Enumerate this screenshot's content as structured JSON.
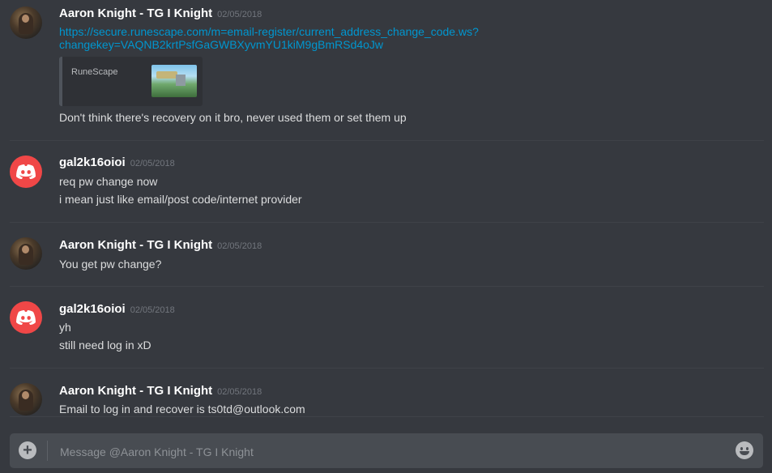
{
  "messages": [
    {
      "username": "Aaron Knight - TG I Knight",
      "timestamp": "02/05/2018",
      "avatar": "photo",
      "link_line1": "https://secure.runescape.com/m=email-register/current_address_change_code.ws?",
      "link_line2": "changekey=VAQNB2krtPsfGaGWBXyvmYU1kiM9gBmRSd4oJw",
      "embed": {
        "provider": "RuneScape"
      },
      "lines": [
        "Don't think there's recovery on it bro, never used them or set them up"
      ]
    },
    {
      "username": "gal2k16oioi",
      "timestamp": "02/05/2018",
      "avatar": "discord",
      "lines": [
        "req pw change now",
        "i mean just like email/post code/internet provider"
      ]
    },
    {
      "username": "Aaron Knight - TG I Knight",
      "timestamp": "02/05/2018",
      "avatar": "photo",
      "lines": [
        "You get pw change?"
      ]
    },
    {
      "username": "gal2k16oioi",
      "timestamp": "02/05/2018",
      "avatar": "discord",
      "lines": [
        "yh",
        "still need log in xD"
      ]
    },
    {
      "username": "Aaron Knight - TG I Knight",
      "timestamp": "02/05/2018",
      "avatar": "photo",
      "lines": [
        "Email to log in and recover is ts0td@outlook.com"
      ]
    }
  ],
  "composer": {
    "placeholder": "Message @Aaron Knight - TG I Knight",
    "add_icon": "plus-circle-icon",
    "emoji_icon": "emoji-smile-icon"
  },
  "colors": {
    "background": "#36393f",
    "link": "#0096cf",
    "discord_avatar": "#f04747",
    "username": "#ffffff",
    "timestamp": "#72767d"
  }
}
